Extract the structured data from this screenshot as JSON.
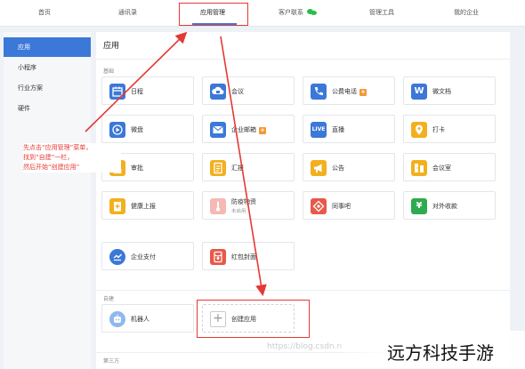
{
  "topnav": {
    "items": [
      {
        "label": "首页"
      },
      {
        "label": "通讯录"
      },
      {
        "label": "应用管理"
      },
      {
        "label": "客户联系",
        "icon": "wechat-icon"
      },
      {
        "label": "管理工具"
      },
      {
        "label": "我的企业"
      }
    ],
    "active_index": 2
  },
  "sidebar": {
    "items": [
      {
        "label": "应用"
      },
      {
        "label": "小程序"
      },
      {
        "label": "行业方案"
      },
      {
        "label": "硬件"
      }
    ],
    "active_index": 0
  },
  "main": {
    "title": "应用",
    "sections": {
      "basic": "基础",
      "custom": "自建",
      "third_party": "第三方"
    },
    "apps": [
      {
        "label": "日程",
        "icon": "calendar-icon",
        "color": "#3b78d8"
      },
      {
        "label": "会议",
        "icon": "cloud-camera-icon",
        "color": "#3b78d8"
      },
      {
        "label": "公费电话",
        "icon": "phone-icon",
        "color": "#3b78d8",
        "badge": "icon"
      },
      {
        "label": "微文档",
        "icon": "document-w-icon",
        "color": "#3b78d8"
      },
      {
        "label": "微盘",
        "icon": "drive-icon",
        "color": "#3b78d8"
      },
      {
        "label": "企业邮箱",
        "icon": "mail-icon",
        "color": "#3b78d8",
        "badge": "icon"
      },
      {
        "label": "直播",
        "icon": "live-icon",
        "color": "#3b78d8",
        "icon_text": "LIVE"
      },
      {
        "label": "打卡",
        "icon": "location-pin-icon",
        "color": "#f2b01e"
      },
      {
        "label": "审批",
        "icon": "stamp-icon",
        "color": "#f2b01e"
      },
      {
        "label": "汇报",
        "icon": "report-icon",
        "color": "#f2b01e"
      },
      {
        "label": "公告",
        "icon": "megaphone-icon",
        "color": "#f2b01e"
      },
      {
        "label": "会议室",
        "icon": "meeting-room-icon",
        "color": "#f2b01e"
      },
      {
        "label": "健康上报",
        "icon": "health-report-icon",
        "color": "#f2b01e"
      },
      {
        "label": "防疫物资",
        "sub": "未启用",
        "icon": "thermometer-icon",
        "color": "#f4b9b4"
      },
      {
        "label": "同事吧",
        "icon": "colleague-icon",
        "color": "#e8594a"
      },
      {
        "label": "对外收款",
        "icon": "payment-yen-icon",
        "color": "#2eaa4f"
      },
      {
        "label": "企业支付",
        "icon": "enterprise-pay-icon",
        "color": "#3b78d8"
      },
      {
        "label": "红包封面",
        "icon": "red-packet-icon",
        "color": "#e8594a"
      }
    ],
    "custom_apps": [
      {
        "label": "机器人",
        "icon": "robot-icon",
        "color": "#8fb9ec"
      }
    ],
    "create_app": {
      "label": "创建应用",
      "icon": "plus-icon"
    }
  },
  "annotation": {
    "lines": [
      "先点击“应用管理”菜单，",
      "找到“自建”一栏，",
      "然后开始“创建应用”"
    ],
    "color": "#e53935"
  },
  "watermark": {
    "url": "https://blog.csdn.n",
    "brand": "远方科技手游"
  }
}
